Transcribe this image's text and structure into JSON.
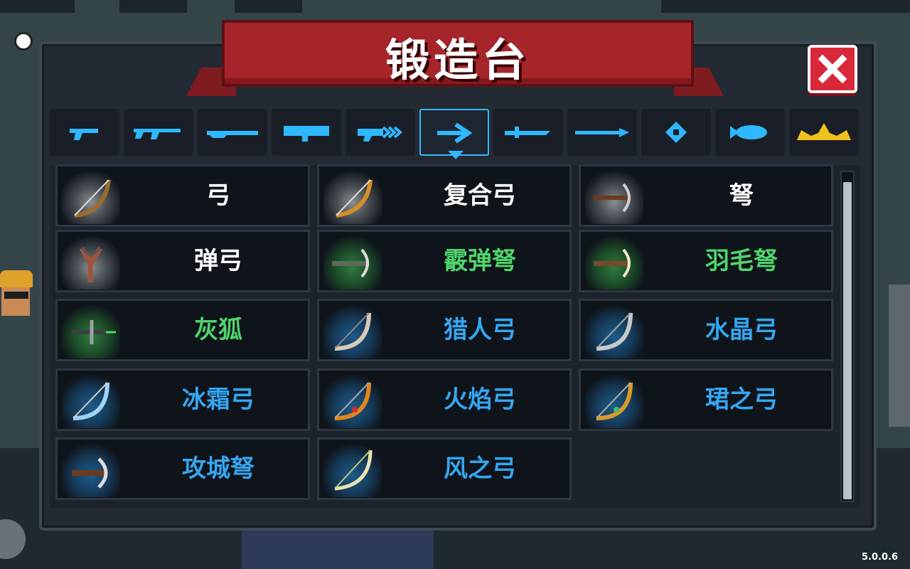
{
  "header": {
    "title": "锻造台"
  },
  "close_button": {
    "icon": "close-icon",
    "color": "#d8283a"
  },
  "version": "5.0.0.6",
  "category_tabs": [
    {
      "icon": "pistol-icon",
      "selected": false
    },
    {
      "icon": "rifle-icon",
      "selected": false
    },
    {
      "icon": "shotgun-icon",
      "selected": false
    },
    {
      "icon": "launcher-icon",
      "selected": false
    },
    {
      "icon": "laser-gun-icon",
      "selected": false
    },
    {
      "icon": "bow-icon",
      "selected": true
    },
    {
      "icon": "sword-icon",
      "selected": false
    },
    {
      "icon": "spear-icon",
      "selected": false
    },
    {
      "icon": "shuriken-icon",
      "selected": false
    },
    {
      "icon": "fish-icon",
      "selected": false
    },
    {
      "icon": "crown-icon",
      "selected": false
    }
  ],
  "items": [
    {
      "name": "弓",
      "rarity": "white",
      "icon": "bow-icon"
    },
    {
      "name": "复合弓",
      "rarity": "white",
      "icon": "compound-bow-icon"
    },
    {
      "name": "弩",
      "rarity": "white",
      "icon": "crossbow-icon"
    },
    {
      "name": "弹弓",
      "rarity": "white",
      "icon": "slingshot-icon"
    },
    {
      "name": "霰弹弩",
      "rarity": "green",
      "icon": "crossbow-icon"
    },
    {
      "name": "羽毛弩",
      "rarity": "green",
      "icon": "crossbow-icon"
    },
    {
      "name": "灰狐",
      "rarity": "green",
      "icon": "crossbow-icon"
    },
    {
      "name": "猎人弓",
      "rarity": "blue",
      "icon": "bow-icon"
    },
    {
      "name": "水晶弓",
      "rarity": "blue",
      "icon": "bow-icon"
    },
    {
      "name": "冰霜弓",
      "rarity": "blue",
      "icon": "bow-icon"
    },
    {
      "name": "火焰弓",
      "rarity": "blue",
      "icon": "bow-icon"
    },
    {
      "name": "珺之弓",
      "rarity": "blue",
      "icon": "bow-icon"
    },
    {
      "name": "攻城弩",
      "rarity": "blue",
      "icon": "crossbow-icon"
    },
    {
      "name": "风之弓",
      "rarity": "blue",
      "icon": "bow-icon"
    }
  ],
  "colors": {
    "accent": "#34b6ff",
    "white_rarity": "#ffffff",
    "green_rarity": "#4fd46b",
    "blue_rarity": "#35a6f0"
  }
}
